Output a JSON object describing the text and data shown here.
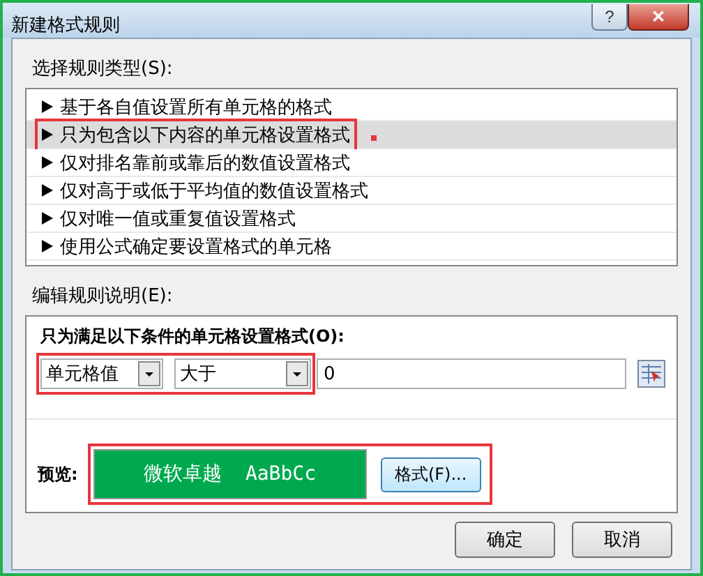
{
  "window": {
    "title": "新建格式规则",
    "help_button": "?",
    "close_button": "✕"
  },
  "rule_type": {
    "label": "选择规则类型(S):",
    "items": [
      {
        "label": "基于各自值设置所有单元格的格式",
        "selected": false,
        "highlighted": false
      },
      {
        "label": "只为包含以下内容的单元格设置格式",
        "selected": true,
        "highlighted": true
      },
      {
        "label": "仅对排名靠前或靠后的数值设置格式",
        "selected": false,
        "highlighted": false
      },
      {
        "label": "仅对高于或低于平均值的数值设置格式",
        "selected": false,
        "highlighted": false
      },
      {
        "label": "仅对唯一值或重复值设置格式",
        "selected": false,
        "highlighted": false
      },
      {
        "label": "使用公式确定要设置格式的单元格",
        "selected": false,
        "highlighted": false
      }
    ]
  },
  "rule_description": {
    "label": "编辑规则说明(E):",
    "heading": "只为满足以下条件的单元格设置格式(O):",
    "condition": {
      "highlighted": true,
      "field": "单元格值",
      "operator": "大于",
      "value": "0"
    },
    "preview": {
      "label": "预览:",
      "highlighted": true,
      "sample": "微软卓越  AaBbCc",
      "color": "#00a94f",
      "format_button": "格式(F)..."
    }
  },
  "buttons": [
    "确定",
    "取消"
  ]
}
